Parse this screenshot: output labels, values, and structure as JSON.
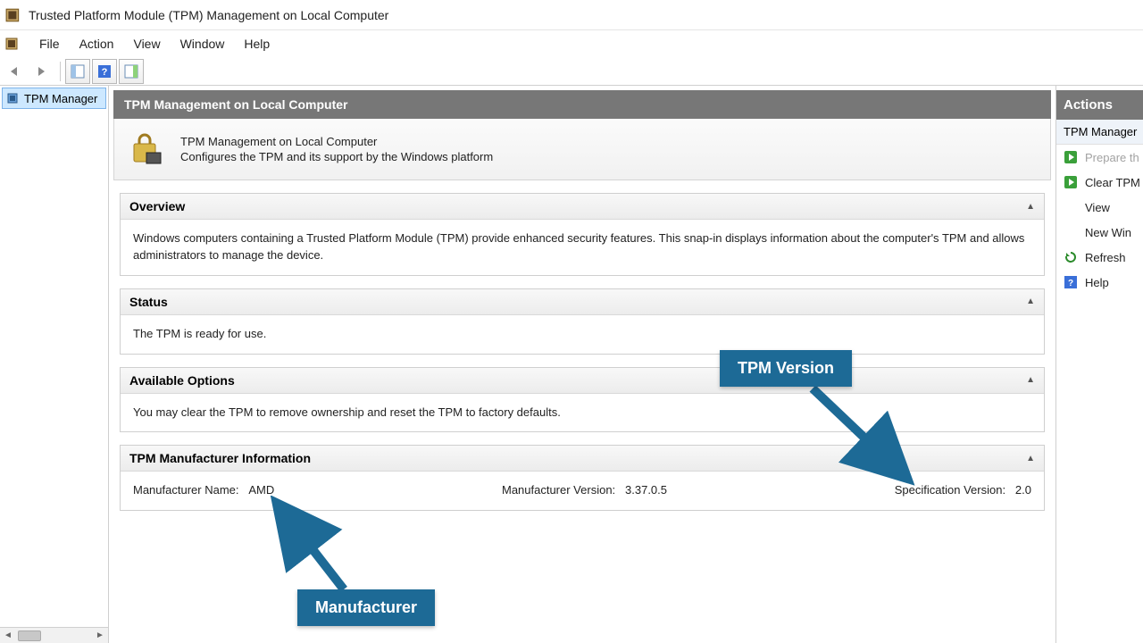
{
  "window": {
    "title": "Trusted Platform Module (TPM) Management on Local Computer"
  },
  "menus": [
    "File",
    "Action",
    "View",
    "Window",
    "Help"
  ],
  "tree": {
    "item0": "TPM Manager"
  },
  "content": {
    "header": "TPM Management on Local Computer",
    "intro_title": "TPM Management on Local Computer",
    "intro_desc": "Configures the TPM and its support by the Windows platform",
    "overview": {
      "title": "Overview",
      "body": "Windows computers containing a Trusted Platform Module (TPM) provide enhanced security features. This snap-in displays information about the computer's TPM and allows administrators to manage the device."
    },
    "status": {
      "title": "Status",
      "body": "The TPM is ready for use."
    },
    "options": {
      "title": "Available Options",
      "body": "You may clear the TPM to remove ownership and reset the TPM to factory defaults."
    },
    "mfr": {
      "title": "TPM Manufacturer Information",
      "name_label": "Manufacturer Name:",
      "name_value": "AMD",
      "ver_label": "Manufacturer Version:",
      "ver_value": "3.37.0.5",
      "spec_label": "Specification Version:",
      "spec_value": "2.0"
    }
  },
  "actions": {
    "header": "Actions",
    "sub": "TPM Manager",
    "items": [
      {
        "label": "Prepare th",
        "icon": "play",
        "disabled": true
      },
      {
        "label": "Clear TPM",
        "icon": "play",
        "disabled": false
      },
      {
        "label": "View",
        "icon": "",
        "disabled": false
      },
      {
        "label": "New Win",
        "icon": "",
        "disabled": false
      },
      {
        "label": "Refresh",
        "icon": "refresh",
        "disabled": false
      },
      {
        "label": "Help",
        "icon": "help",
        "disabled": false
      }
    ]
  },
  "callouts": {
    "version": "TPM Version",
    "manufacturer": "Manufacturer"
  }
}
